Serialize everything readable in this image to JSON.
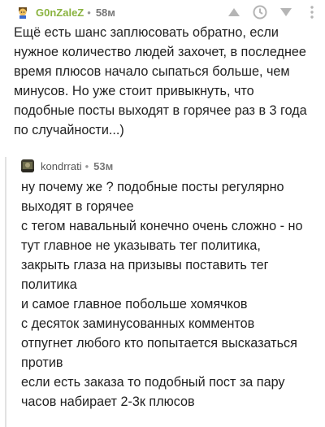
{
  "comments": [
    {
      "author": "G0nZaleZ",
      "separator": "•",
      "time": "58м",
      "lines": [
        "Ещё есть шанс заплюсовать обратно, если",
        "нужное количество людей захочет, в последнее",
        "время плюсов начало сыпаться больше, чем",
        "минусов. Но уже стоит привыкнуть, что",
        "подобные посты выходят в горячее раз в 3 года",
        "по случайности...)"
      ],
      "icons": [
        "avatar-face",
        "upvote-icon",
        "save-clock-icon",
        "downvote-icon",
        "more-icon"
      ]
    },
    {
      "author": "kondrrati",
      "separator": "•",
      "time": "53м",
      "lines": [
        "ну почему же ? подобные посты регулярно",
        "выходят в горячее",
        "с тегом навальный конечно очень сложно - но",
        "тут главное не указывать тег политика,",
        "закрыть глаза на призывы поставить тег",
        "политика",
        "и самое главное побольше хомячков",
        "с десяток заминусованных комментов",
        "отпугнет любого кто попытается высказаться",
        "против",
        "если есть заказа то подобный пост за пару",
        "часов набирает 2-3к плюсов"
      ],
      "icons": [
        "avatar-photo"
      ]
    }
  ],
  "colors": {
    "username_primary": "#8ab33f",
    "icon_gray": "#b5b5b5",
    "thread_line": "#e2e2e2"
  }
}
